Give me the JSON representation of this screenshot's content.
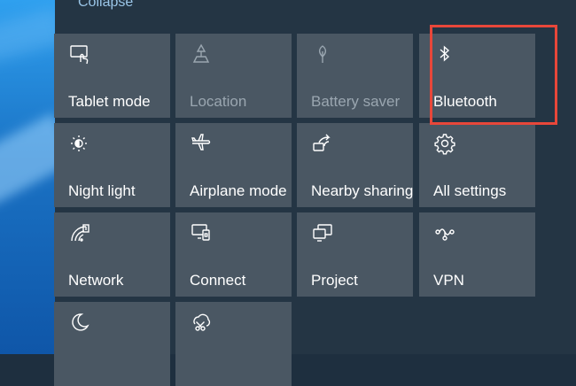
{
  "action_center": {
    "collapse_label": "Collapse",
    "tiles": [
      {
        "label": "Tablet mode",
        "icon": "tablet-mode-icon",
        "state": "normal"
      },
      {
        "label": "Location",
        "icon": "location-icon",
        "state": "disabled"
      },
      {
        "label": "Battery saver",
        "icon": "battery-saver-icon",
        "state": "disabled"
      },
      {
        "label": "Bluetooth",
        "icon": "bluetooth-icon",
        "state": "normal",
        "highlighted": true
      },
      {
        "label": "Night light",
        "icon": "night-light-icon",
        "state": "normal"
      },
      {
        "label": "Airplane mode",
        "icon": "airplane-icon",
        "state": "normal"
      },
      {
        "label": "Nearby sharing",
        "icon": "nearby-sharing-icon",
        "state": "normal"
      },
      {
        "label": "All settings",
        "icon": "gear-icon",
        "state": "normal"
      },
      {
        "label": "Network",
        "icon": "network-icon",
        "state": "normal"
      },
      {
        "label": "Connect",
        "icon": "connect-icon",
        "state": "normal"
      },
      {
        "label": "Project",
        "icon": "project-icon",
        "state": "normal"
      },
      {
        "label": "VPN",
        "icon": "vpn-icon",
        "state": "normal"
      },
      {
        "label": "",
        "icon": "focus-assist-moon-icon",
        "state": "normal"
      },
      {
        "label": "",
        "icon": "snip-sketch-icon",
        "state": "normal"
      }
    ]
  },
  "colors": {
    "highlight": "#e8473a",
    "tile": "#4a5763",
    "panel": "#243544",
    "collapse_link": "#9bc6e8"
  }
}
